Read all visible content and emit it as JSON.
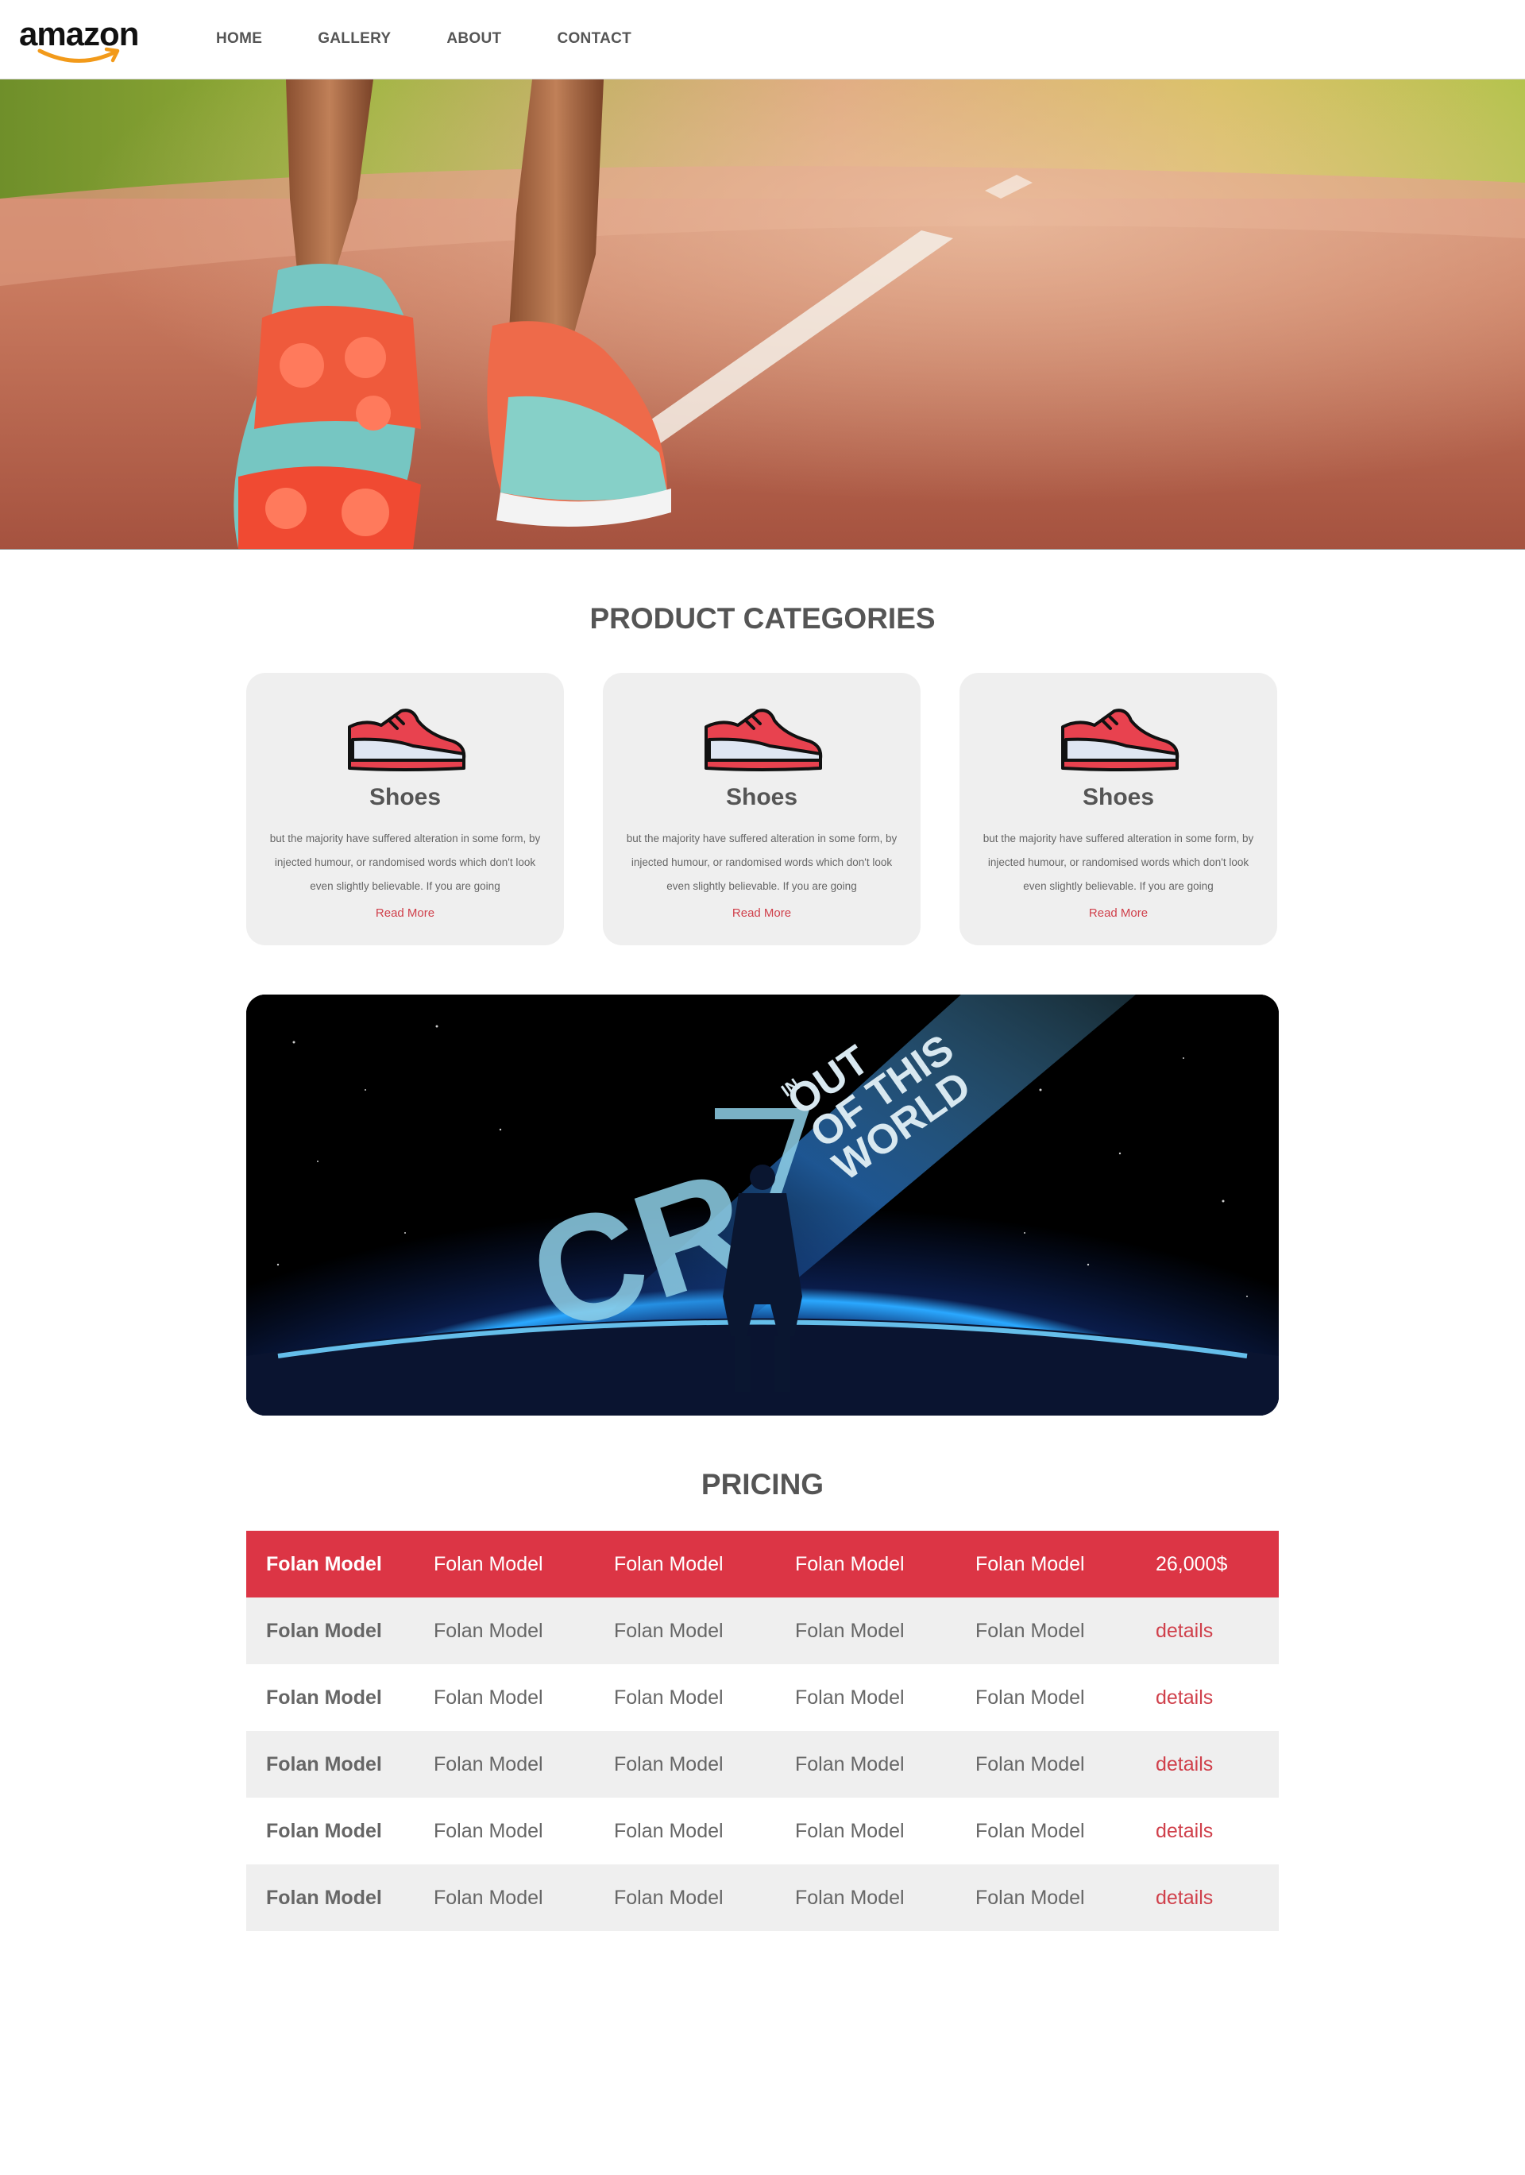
{
  "header": {
    "logo_text": "amazon",
    "nav": [
      "HOME",
      "GALLERY",
      "ABOUT",
      "CONTACT"
    ]
  },
  "categories": {
    "title": "PRODUCT CATEGORIES",
    "cards": [
      {
        "title": "Shoes",
        "desc": "but the majority have suffered alteration in some form, by injected humour, or randomised words which don't look even slightly believable. If you are going",
        "link": "Read More"
      },
      {
        "title": "Shoes",
        "desc": "but the majority have suffered alteration in some form, by injected humour, or randomised words which don't look even slightly believable. If you are going",
        "link": "Read More"
      },
      {
        "title": "Shoes",
        "desc": "but the majority have suffered alteration in some form, by injected humour, or randomised words which don't look even slightly believable. If you are going",
        "link": "Read More"
      }
    ]
  },
  "banner": {
    "logo_text": "CR",
    "small_text": "IN",
    "line1": "OUT",
    "line2": "OF THIS",
    "line3": "WORLD"
  },
  "pricing": {
    "title": "PRICING",
    "header": [
      "Folan Model",
      "Folan Model",
      "Folan Model",
      "Folan Model",
      "Folan Model",
      "26,000$"
    ],
    "rows": [
      [
        "Folan Model",
        "Folan Model",
        "Folan Model",
        "Folan Model",
        "Folan Model",
        "details"
      ],
      [
        "Folan Model",
        "Folan Model",
        "Folan Model",
        "Folan Model",
        "Folan Model",
        "details"
      ],
      [
        "Folan Model",
        "Folan Model",
        "Folan Model",
        "Folan Model",
        "Folan Model",
        "details"
      ],
      [
        "Folan Model",
        "Folan Model",
        "Folan Model",
        "Folan Model",
        "Folan Model",
        "details"
      ],
      [
        "Folan Model",
        "Folan Model",
        "Folan Model",
        "Folan Model",
        "Folan Model",
        "details"
      ]
    ]
  },
  "colors": {
    "accent": "#dc3545",
    "link": "#d0404b",
    "card_bg": "#efefef",
    "text": "#555555"
  }
}
